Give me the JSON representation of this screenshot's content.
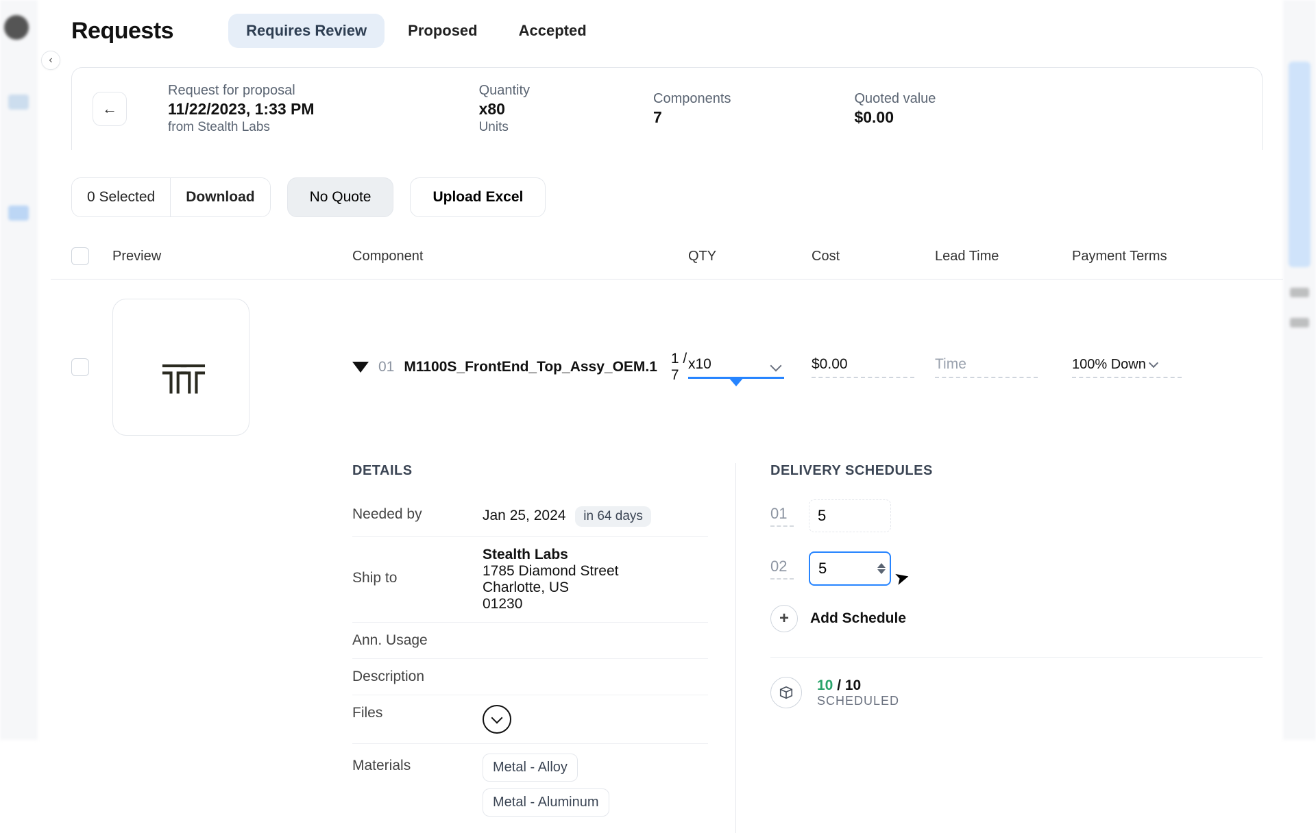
{
  "page": {
    "title": "Requests"
  },
  "tabs": {
    "requires_review": "Requires Review",
    "proposed": "Proposed",
    "accepted": "Accepted"
  },
  "summary": {
    "rfp_label": "Request for proposal",
    "rfp_datetime": "11/22/2023, 1:33 PM",
    "rfp_from": "from Stealth Labs",
    "qty_label": "Quantity",
    "qty_value": "x80",
    "qty_units": "Units",
    "components_label": "Components",
    "components_value": "7",
    "quoted_label": "Quoted value",
    "quoted_value": "$0.00"
  },
  "toolbar": {
    "selected": "0 Selected",
    "download": "Download",
    "no_quote": "No Quote",
    "upload_excel": "Upload Excel"
  },
  "table": {
    "headers": {
      "preview": "Preview",
      "component": "Component",
      "qty": "QTY",
      "cost": "Cost",
      "lead_time": "Lead Time",
      "payment_terms": "Payment Terms"
    }
  },
  "row": {
    "index": "01",
    "name": "M1100S_FrontEnd_Top_Assy_OEM.1",
    "pos": "1 / 7",
    "qty": "x10",
    "cost": "$0.00",
    "lead_time_placeholder": "Time",
    "terms": "100% Down"
  },
  "details": {
    "title": "DETAILS",
    "needed_by_label": "Needed by",
    "needed_by_date": "Jan 25, 2024",
    "needed_by_chip": "in 64 days",
    "ship_to_label": "Ship to",
    "ship_name": "Stealth Labs",
    "ship_street": "1785 Diamond Street",
    "ship_city": "Charlotte, US",
    "ship_zip": "01230",
    "ann_usage_label": "Ann. Usage",
    "description_label": "Description",
    "files_label": "Files",
    "materials_label": "Materials",
    "materials": [
      "Metal - Alloy",
      "Metal - Aluminum"
    ]
  },
  "schedule": {
    "title": "DELIVERY SCHEDULES",
    "rows": [
      {
        "idx": "01",
        "qty": "5"
      },
      {
        "idx": "02",
        "qty": "5"
      }
    ],
    "add_label": "Add Schedule",
    "done": "10",
    "total_sep": " / 10",
    "scheduled_label": "SCHEDULED"
  }
}
